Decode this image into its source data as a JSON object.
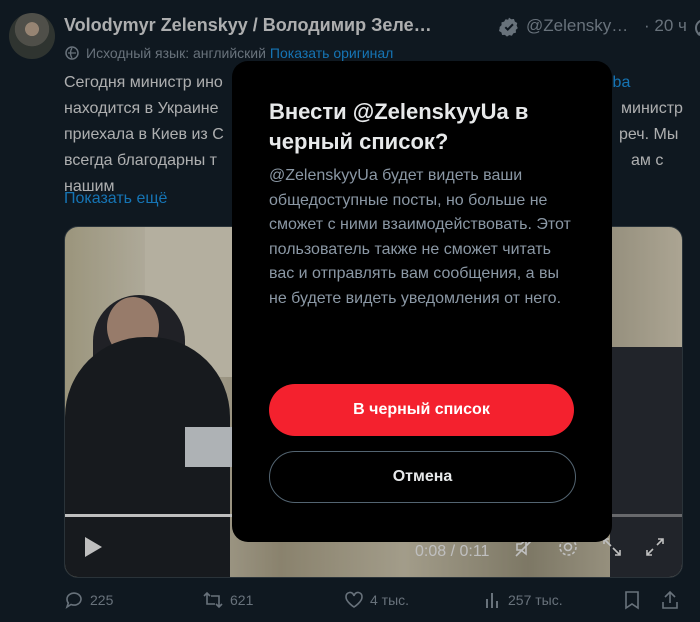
{
  "tweet": {
    "author_name": "Volodymyr Zelenskyy / Володимир Зеле…",
    "handle": "@Zelensky…",
    "time": "· 20 ч",
    "translation_note": "Исходный язык: английский",
    "show_original": "Показать оригинал",
    "text_lines": [
      "Сегодня министр ино",
      "находится в Украине",
      "приехала в Киев из С",
      "всегда благодарны т",
      "нашим"
    ],
    "text_right_fragments": [
      "iba",
      "министр",
      "реч. Мы",
      "ам с"
    ],
    "show_more": "Показать ещё",
    "video": {
      "time_readout": "0:08 / 0:11",
      "progress": 0.727
    },
    "actions": {
      "replies": "225",
      "reposts": "621",
      "likes": "4 тыс.",
      "views": "257 тыс."
    }
  },
  "modal": {
    "title": "Внести @ZelenskyyUa в черный список?",
    "body": "@ZelenskyyUa будет видеть ваши общедоступные посты, но больше не сможет с ними взаимодействовать. Этот пользователь также не сможет читать вас и отправлять вам сообщения, а вы не будете видеть уведомления от него.",
    "confirm_label": "В черный список",
    "cancel_label": "Отмена"
  },
  "colors": {
    "background": "#15202b",
    "accent_link": "#1d9bf0",
    "danger": "#f4212e",
    "modal_bg": "#000000"
  },
  "icons": [
    "verified-badge-icon",
    "grok-icon",
    "translate-icon",
    "play-icon",
    "mute-icon",
    "settings-icon",
    "pip-icon",
    "fullscreen-icon",
    "reply-icon",
    "repost-icon",
    "like-icon",
    "views-icon",
    "bookmark-icon",
    "share-icon"
  ]
}
